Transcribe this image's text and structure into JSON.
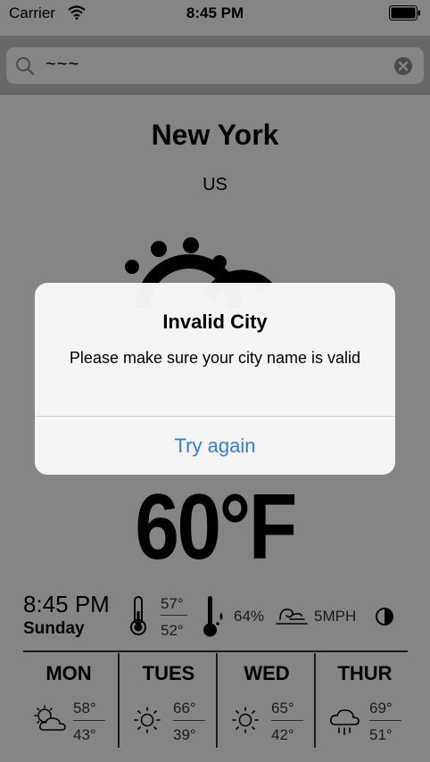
{
  "status_bar": {
    "carrier": "Carrier",
    "time": "8:45 PM"
  },
  "search": {
    "value": "~~~"
  },
  "weather": {
    "city": "New York",
    "country": "US",
    "temperature": "60°F",
    "time": "8:45 PM",
    "day": "Sunday",
    "high": "57°",
    "low": "52°",
    "humidity": "64%",
    "wind": "5MPH"
  },
  "forecast": [
    {
      "day": "MON",
      "high": "58°",
      "low": "43°",
      "icon": "partly-cloudy-icon"
    },
    {
      "day": "TUES",
      "high": "66°",
      "low": "39°",
      "icon": "sun-icon"
    },
    {
      "day": "WED",
      "high": "65°",
      "low": "42°",
      "icon": "sun-icon"
    },
    {
      "day": "THUR",
      "high": "69°",
      "low": "51°",
      "icon": "rain-cloud-icon"
    }
  ],
  "alert": {
    "title": "Invalid City",
    "message": "Please make sure your city name is valid",
    "button": "Try again"
  },
  "colors": {
    "accent": "#2f7de1",
    "overlay": "rgba(0,0,0,0.48)"
  }
}
